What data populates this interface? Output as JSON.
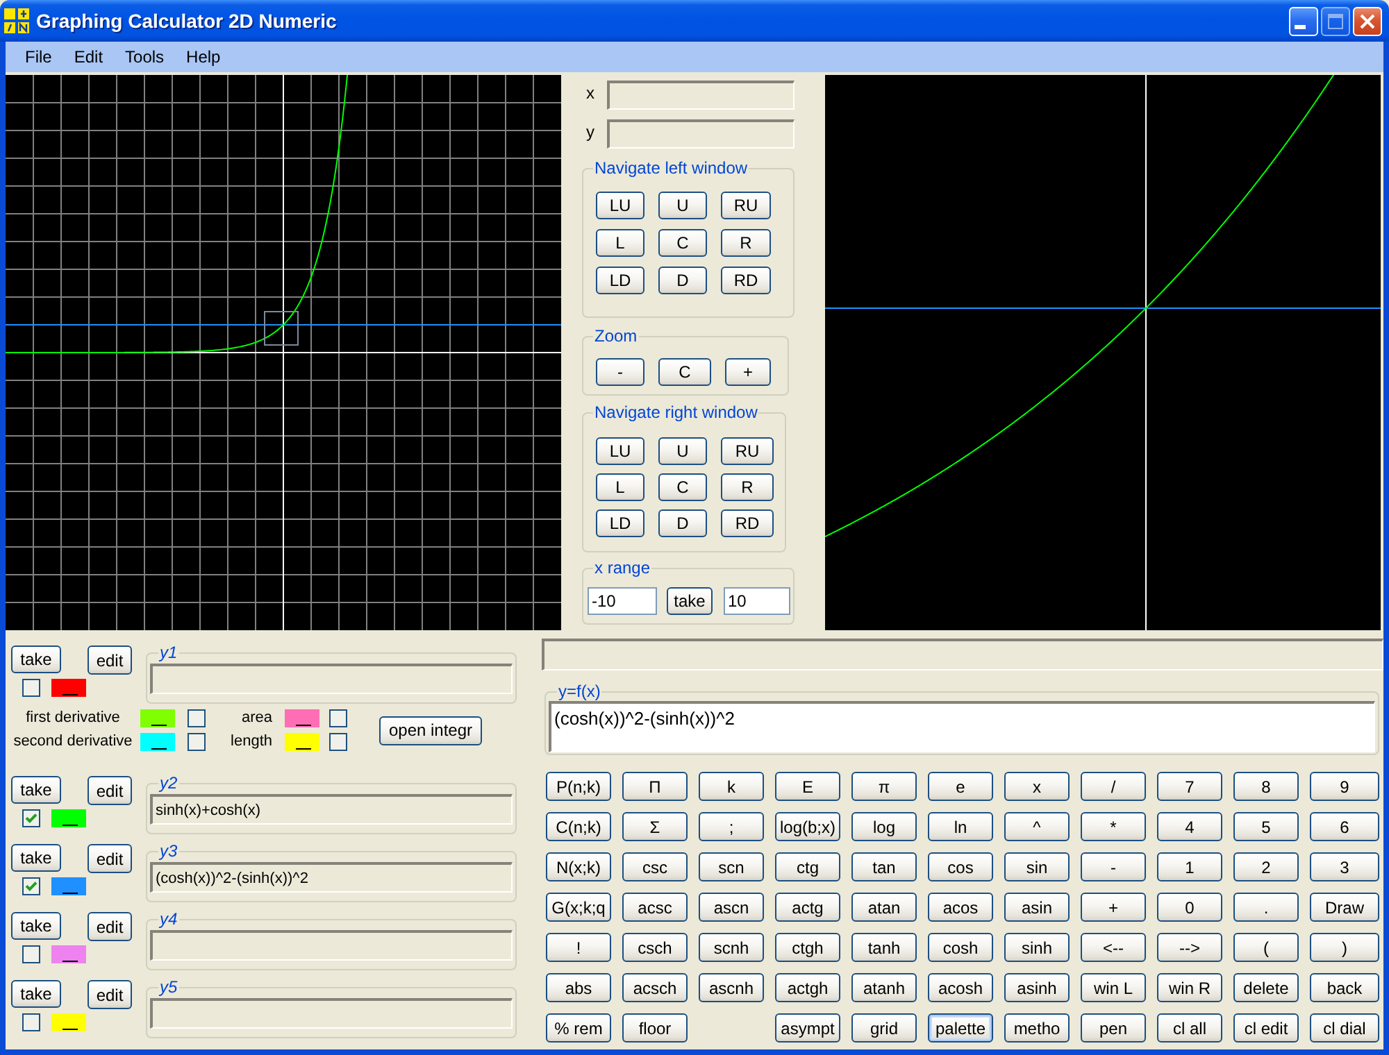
{
  "window": {
    "title": "Graphing Calculator 2D Numeric",
    "maximize_disabled": true
  },
  "menu": [
    "File",
    "Edit",
    "Tools",
    "Help"
  ],
  "cursor_fields": [
    {
      "label": "x"
    },
    {
      "label": "y"
    }
  ],
  "navigate_left": {
    "title": "Navigate left window",
    "buttons": [
      "LU",
      "U",
      "RU",
      "L",
      "C",
      "R",
      "LD",
      "D",
      "RD"
    ]
  },
  "zoom": {
    "title": "Zoom",
    "buttons": [
      "-",
      "C",
      "+"
    ]
  },
  "navigate_right": {
    "title": "Navigate right window",
    "buttons": [
      "LU",
      "U",
      "RU",
      "L",
      "C",
      "R",
      "LD",
      "D",
      "RD"
    ]
  },
  "x_range": {
    "title": "x range",
    "from": "-10",
    "button": "take",
    "to": "10"
  },
  "functions": [
    {
      "name": "y1",
      "buttons": [
        "take",
        "edit"
      ],
      "checked": false,
      "color": "#ff0000"
    },
    {
      "name": "y2",
      "buttons": [
        "take",
        "edit"
      ],
      "checked": true,
      "color": "#00ff00",
      "value": "sinh(x)+cosh(x)"
    },
    {
      "name": "y3",
      "buttons": [
        "take",
        "edit"
      ],
      "checked": true,
      "color": "#1e90ff",
      "value": "(cosh(x))^2-(sinh(x))^2"
    },
    {
      "name": "y4",
      "buttons": [
        "take",
        "edit"
      ],
      "checked": false,
      "color": "#ee82ee"
    },
    {
      "name": "y5",
      "buttons": [
        "take",
        "edit"
      ],
      "checked": false,
      "color": "#ffff00"
    }
  ],
  "extras": {
    "items": [
      {
        "label": "first derivative",
        "color": "#80ff00",
        "checked": false
      },
      {
        "label": "area",
        "color": "#ff6eb4",
        "checked": false
      },
      {
        "label": "second derivative",
        "color": "#00ffff",
        "checked": false
      },
      {
        "label": "length",
        "color": "#ffff00",
        "checked": false
      }
    ],
    "button": "open integr"
  },
  "expression": {
    "legend": "y=f(x)",
    "value": "(cosh(x))^2-(sinh(x))^2"
  },
  "keypad": {
    "columns": [
      [
        {
          "label": "P(n;k)",
          "focused": false
        },
        {
          "label": "C(n;k)",
          "focused": false
        },
        {
          "label": "N(x;k)",
          "focused": false
        },
        {
          "label": "G(x;k;q",
          "focused": false
        },
        {
          "label": "!",
          "focused": false
        },
        {
          "label": "abs",
          "focused": false
        },
        {
          "label": "% rem",
          "focused": false
        }
      ],
      [
        {
          "label": "Π",
          "focused": false
        },
        {
          "label": "Σ",
          "focused": false
        },
        {
          "label": "csc",
          "focused": false
        },
        {
          "label": "acsc",
          "focused": false
        },
        {
          "label": "csch",
          "focused": false
        },
        {
          "label": "acsch",
          "focused": false
        },
        {
          "label": "floor",
          "focused": false
        }
      ],
      [
        {
          "label": "k",
          "focused": false
        },
        {
          "label": ";",
          "focused": false
        },
        {
          "label": "scn",
          "focused": false
        },
        {
          "label": "ascn",
          "focused": false
        },
        {
          "label": "scnh",
          "focused": false
        },
        {
          "label": "ascnh",
          "focused": false
        }
      ],
      [
        {
          "label": "E",
          "focused": false
        },
        {
          "label": "log(b;x)",
          "focused": false
        },
        {
          "label": "ctg",
          "focused": false
        },
        {
          "label": "actg",
          "focused": false
        },
        {
          "label": "ctgh",
          "focused": false
        },
        {
          "label": "actgh",
          "focused": false
        },
        {
          "label": "asympt",
          "focused": false
        }
      ],
      [
        {
          "label": "π",
          "focused": false
        },
        {
          "label": "log",
          "focused": false
        },
        {
          "label": "tan",
          "focused": false
        },
        {
          "label": "atan",
          "focused": false
        },
        {
          "label": "tanh",
          "focused": false
        },
        {
          "label": "atanh",
          "focused": false
        },
        {
          "label": "grid",
          "focused": false
        }
      ],
      [
        {
          "label": "e",
          "focused": false
        },
        {
          "label": "ln",
          "focused": false
        },
        {
          "label": "cos",
          "focused": false
        },
        {
          "label": "acos",
          "focused": false
        },
        {
          "label": "cosh",
          "focused": false
        },
        {
          "label": "acosh",
          "focused": false
        },
        {
          "label": "palette",
          "focused": true
        }
      ],
      [
        {
          "label": "x",
          "focused": false
        },
        {
          "label": "^",
          "focused": false
        },
        {
          "label": "sin",
          "focused": false
        },
        {
          "label": "asin",
          "focused": false
        },
        {
          "label": "sinh",
          "focused": false
        },
        {
          "label": "asinh",
          "focused": false
        },
        {
          "label": "metho",
          "focused": false
        }
      ],
      [
        {
          "label": "/",
          "focused": false
        },
        {
          "label": "*",
          "focused": false
        },
        {
          "label": "-",
          "focused": false
        },
        {
          "label": "+",
          "focused": false
        },
        {
          "label": "<--",
          "focused": false
        },
        {
          "label": "win L",
          "focused": false
        },
        {
          "label": "pen",
          "focused": false
        }
      ],
      [
        {
          "label": "7",
          "focused": false
        },
        {
          "label": "4",
          "focused": false
        },
        {
          "label": "1",
          "focused": false
        },
        {
          "label": "0",
          "focused": false
        },
        {
          "label": "-->",
          "focused": false
        },
        {
          "label": "win R",
          "focused": false
        },
        {
          "label": "cl all",
          "focused": false
        }
      ],
      [
        {
          "label": "8",
          "focused": false
        },
        {
          "label": "5",
          "focused": false
        },
        {
          "label": "2",
          "focused": false
        },
        {
          "label": ".",
          "focused": false
        },
        {
          "label": "(",
          "focused": false
        },
        {
          "label": "delete",
          "focused": false
        },
        {
          "label": "cl edit",
          "focused": false
        }
      ],
      [
        {
          "label": "9",
          "focused": false
        },
        {
          "label": "6",
          "focused": false
        },
        {
          "label": "3",
          "focused": false
        },
        {
          "label": "Draw",
          "focused": false
        },
        {
          "label": ")",
          "focused": false
        },
        {
          "label": "back",
          "focused": false
        },
        {
          "label": "cl dial",
          "focused": false
        }
      ]
    ]
  }
}
